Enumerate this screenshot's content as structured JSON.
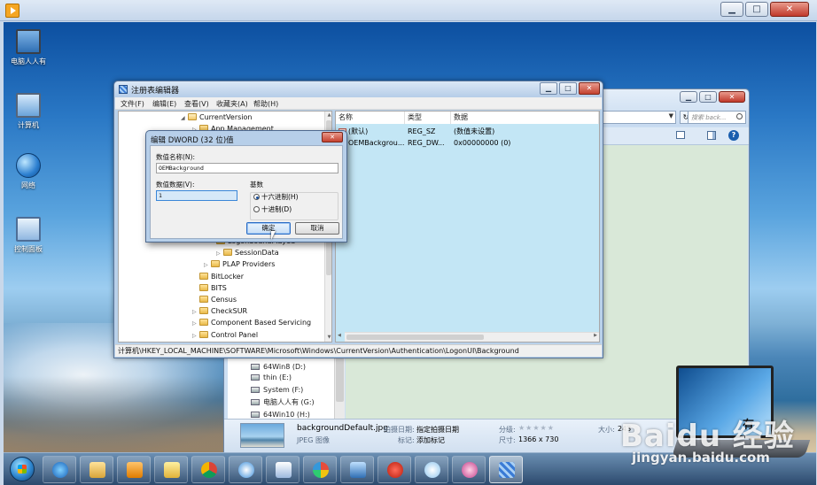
{
  "outer_window": {
    "buttons": {
      "minimize": "▁",
      "maximize": "□",
      "close": "✕"
    }
  },
  "desktop": {
    "icons": [
      {
        "label": "电脑人人有",
        "icon": "monitor-icon"
      },
      {
        "label": "计算机",
        "icon": "computer-icon"
      },
      {
        "label": "网络",
        "icon": "network-icon"
      },
      {
        "label": "控制面板",
        "icon": "control-panel-icon"
      }
    ]
  },
  "explorer": {
    "search_placeholder": "搜索 back...",
    "drives": [
      "64Win8 (D:)",
      "thin (E:)",
      "System (F:)",
      "电脑人人有 (G:)",
      "64Win10 (H:)"
    ],
    "details": {
      "filename": "backgroundDefault.jpg",
      "filetype": "JPEG 图像",
      "date_label": "拍摄日期:",
      "date_value": "指定拍摄日期",
      "tag_label": "标记:",
      "tag_value": "添加标记",
      "rating_label": "分级:",
      "rating_stars": "★★★★★",
      "size_label": "大小:",
      "size_value": "243",
      "dim_label": "尺寸:",
      "dim_value": "1366 x 730"
    }
  },
  "regedit": {
    "title": "注册表编辑器",
    "buttons": {
      "minimize": "▁",
      "maximize": "□",
      "close": "✕"
    },
    "menu": [
      "文件(F)",
      "编辑(E)",
      "查看(V)",
      "收藏夹(A)",
      "帮助(H)"
    ],
    "tree": [
      {
        "label": "CurrentVersion",
        "expanded": true
      },
      {
        "label": "App Management",
        "expanded": false
      },
      {
        "label": "LogonSoundPlayed",
        "expanded": false
      },
      {
        "label": "SessionData",
        "expanded": false
      },
      {
        "label": "PLAP Providers",
        "expanded": false
      },
      {
        "label": "BitLocker",
        "expanded": false
      },
      {
        "label": "BITS",
        "expanded": false
      },
      {
        "label": "Census",
        "expanded": false
      },
      {
        "label": "CheckSUR",
        "expanded": false
      },
      {
        "label": "Component Based Servicing",
        "expanded": false
      },
      {
        "label": "Control Panel",
        "expanded": false
      }
    ],
    "columns": [
      "名称",
      "类型",
      "数据"
    ],
    "values": [
      {
        "name": "(默认)",
        "type": "REG_SZ",
        "data": "(数值未设置)"
      },
      {
        "name": "OEMBackgrou...",
        "type": "REG_DW...",
        "data": "0x00000000 (0)"
      }
    ],
    "status": "计算机\\HKEY_LOCAL_MACHINE\\SOFTWARE\\Microsoft\\Windows\\CurrentVersion\\Authentication\\LogonUI\\Background"
  },
  "dword_dialog": {
    "title": "编辑 DWORD (32 位)值",
    "close": "✕",
    "name_label": "数值名称(N):",
    "name_value": "OEMBackground",
    "data_label": "数值数据(V):",
    "data_value": "1",
    "base_label": "基数",
    "base_options": [
      {
        "label": "十六进制(H)",
        "selected": true
      },
      {
        "label": "十进制(D)",
        "selected": false
      }
    ],
    "ok_label": "确定",
    "cancel_label": "取消"
  },
  "taskbar": {
    "items": [
      "ie-icon",
      "folder-icon",
      "media-player-icon",
      "folders-icon",
      "chrome-icon",
      "cloud-icon",
      "document-icon",
      "paint-icon",
      "remote-desktop-icon",
      "chess-icon",
      "gear-app-icon",
      "mascot-icon",
      "regedit-icon"
    ]
  },
  "overlay": {
    "laptop_text": "有",
    "watermark": "Baidu 经验",
    "watermark_url": "jingyan.baidu.com"
  }
}
